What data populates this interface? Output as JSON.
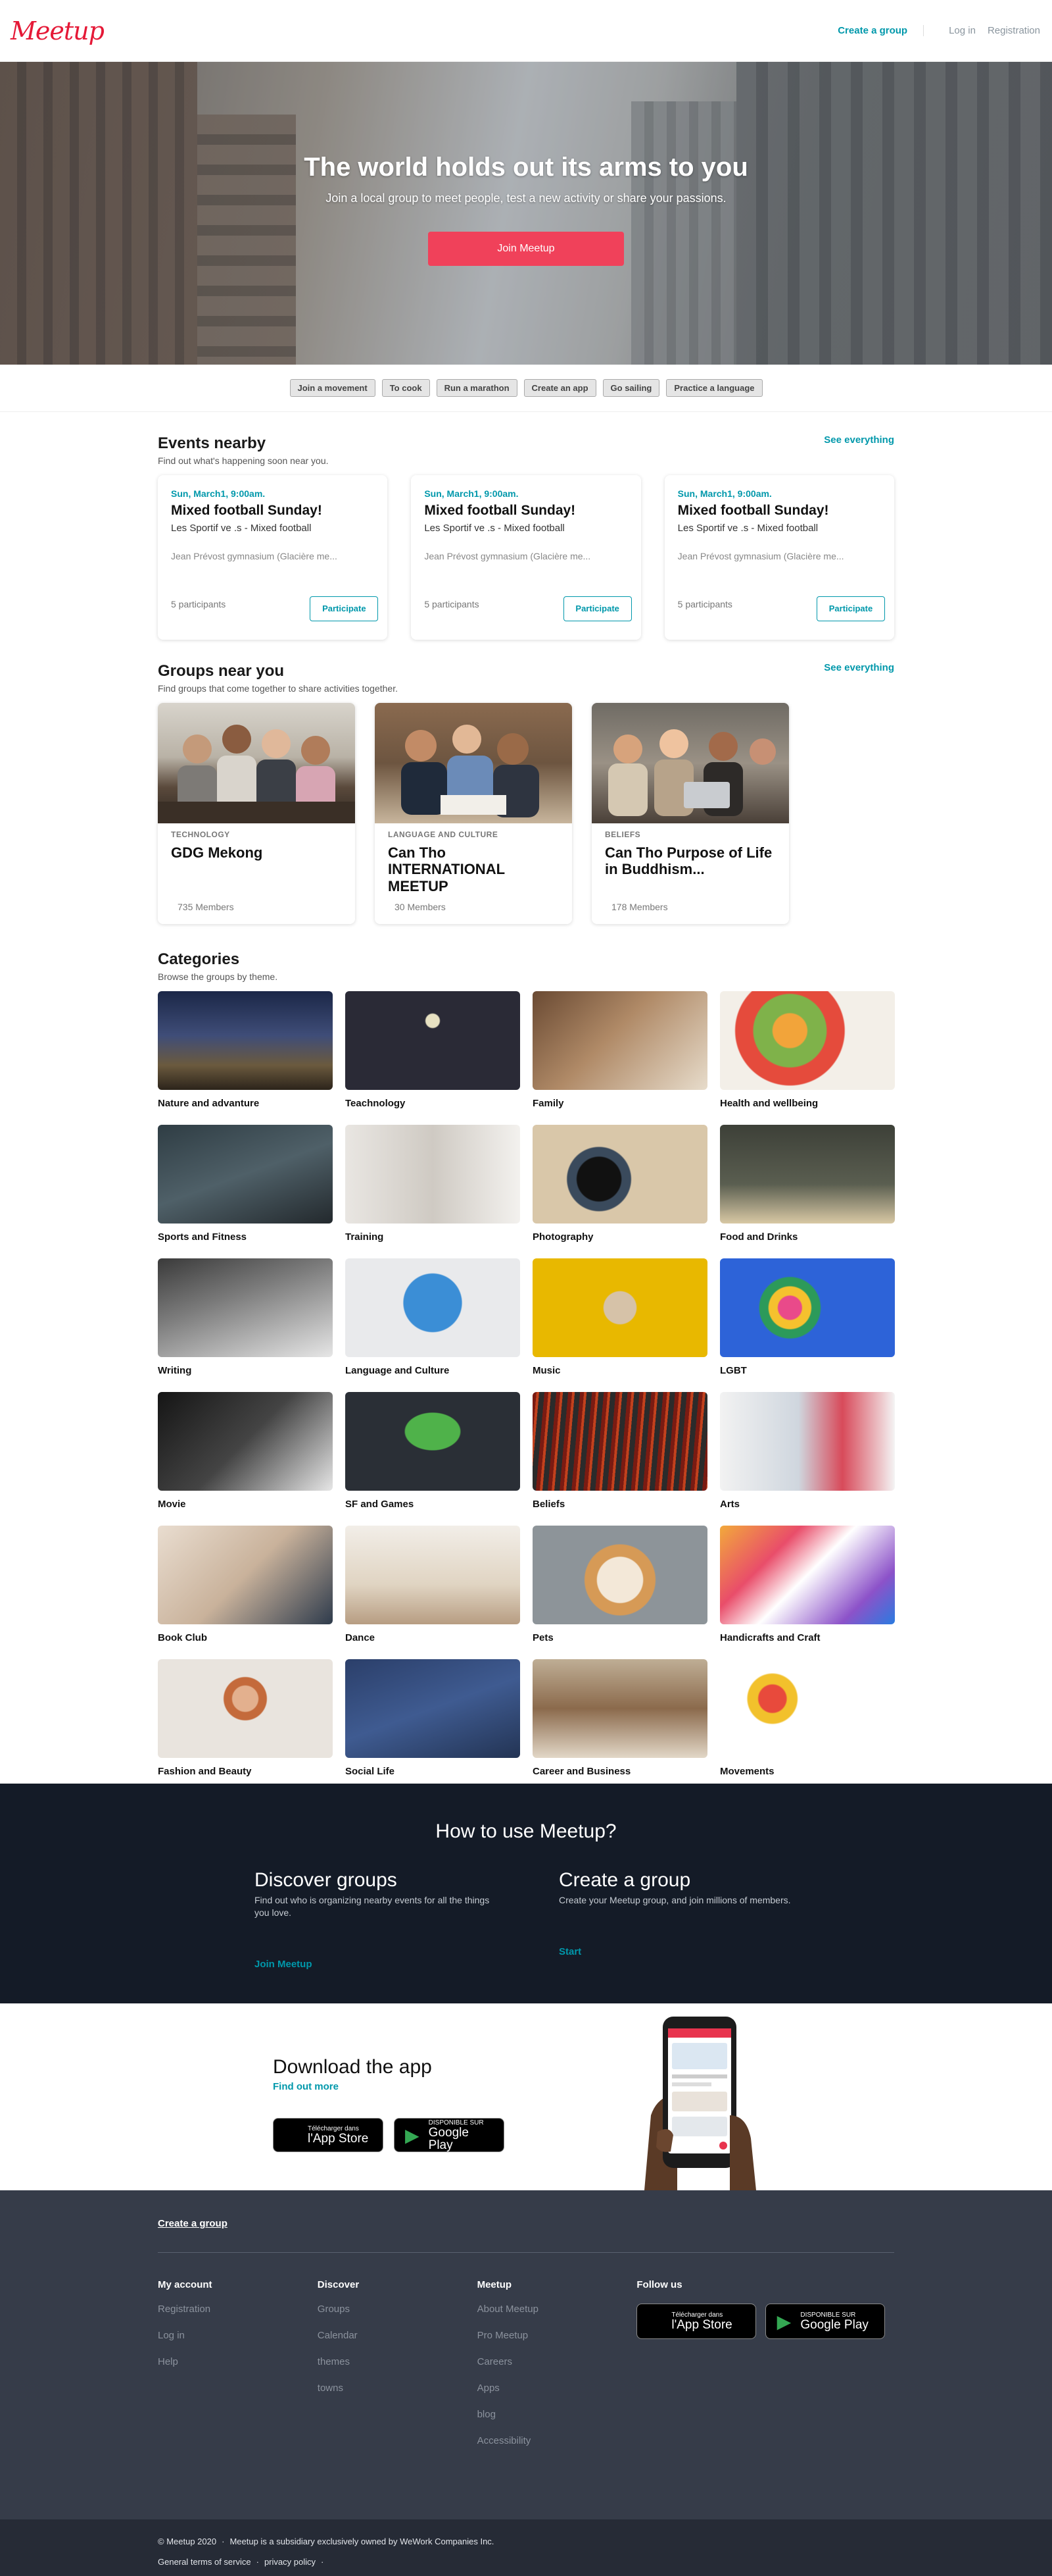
{
  "header": {
    "logo": "Meetup",
    "create_group": "Create a group",
    "login": "Log in",
    "registration": "Registration"
  },
  "hero": {
    "title": "The world holds out its arms to you",
    "subtitle": "Join a local group to meet people, test a new activity or share your passions.",
    "button": "Join Meetup"
  },
  "chips": [
    "Join a movement",
    "To cook",
    "Run a marathon",
    "Create an app",
    "Go sailing",
    "Practice a language"
  ],
  "events": {
    "title": "Events nearby",
    "subtitle": "Find out what's happening soon near you.",
    "see_all": "See everything",
    "items": [
      {
        "date": "Sun, March1, 9:00am.",
        "title": "Mixed football Sunday!",
        "group": "Les Sportif ve .s - Mixed football",
        "place": "Jean Prévost gymnasium (Glacière me...",
        "participants": "5 participants",
        "button": "Participate"
      },
      {
        "date": "Sun, March1, 9:00am.",
        "title": "Mixed football Sunday!",
        "group": "Les Sportif ve .s - Mixed football",
        "place": "Jean Prévost gymnasium (Glacière me...",
        "participants": "5 participants",
        "button": "Participate"
      },
      {
        "date": "Sun, March1, 9:00am.",
        "title": "Mixed football Sunday!",
        "group": "Les Sportif ve .s - Mixed football",
        "place": "Jean Prévost gymnasium (Glacière me...",
        "participants": "5 participants",
        "button": "Participate"
      }
    ]
  },
  "groups": {
    "title": "Groups near you",
    "subtitle": "Find groups that come together to share activities together.",
    "see_all": "See everything",
    "items": [
      {
        "category": "TECHNOLOGY",
        "name": "GDG Mekong",
        "members": "735 Members"
      },
      {
        "category": "LANGUAGE AND CULTURE",
        "name": "Can Tho INTERNATIONAL MEETUP",
        "members": "30 Members"
      },
      {
        "category": "BELIEFS",
        "name": "Can Tho Purpose of Life in Buddhism...",
        "members": "178 Members"
      }
    ]
  },
  "categories": {
    "title": "Categories",
    "subtitle": "Browse the groups by theme.",
    "items": [
      "Nature and advanture",
      "Teachnology",
      "Family",
      "Health and wellbeing",
      "Sports and Fitness",
      "Training",
      "Photography",
      "Food and Drinks",
      "Writing",
      "Language and Culture",
      "Music",
      "LGBT",
      "Movie",
      "SF and Games",
      "Beliefs",
      "Arts",
      "Book Club",
      "Dance",
      "Pets",
      "Handicrafts and Craft",
      "Fashion and Beauty",
      "Social Life",
      "Career and Business",
      "Movements"
    ]
  },
  "howto": {
    "title": "How to use Meetup?",
    "discover": {
      "title": "Discover groups",
      "text": "Find out who is organizing nearby events for all the things you love.",
      "link": "Join Meetup"
    },
    "create": {
      "title": "Create a group",
      "text": "Create your Meetup group, and join millions of members.",
      "link": "Start"
    }
  },
  "app": {
    "title": "Download the app",
    "link": "Find out more",
    "appstore_small": "Télécharger dans",
    "appstore_big": "l'App Store",
    "play_small": "DISPONIBLE SUR",
    "play_big": "Google Play"
  },
  "footer": {
    "create_group": "Create a group",
    "my_account": {
      "title": "My account",
      "links": [
        "Registration",
        "Log in",
        "Help"
      ]
    },
    "discover": {
      "title": "Discover",
      "links": [
        "Groups",
        "Calendar",
        "themes",
        "towns"
      ]
    },
    "meetup": {
      "title": "Meetup",
      "links": [
        "About Meetup",
        "Pro Meetup",
        "Careers",
        "Apps",
        "blog",
        "Accessibility"
      ]
    },
    "follow": {
      "title": "Follow us"
    }
  },
  "legal": {
    "copyright": "© Meetup 2020",
    "sep": "·",
    "subsidiary": "Meetup is a subsidiary exclusively owned by WeWork Companies Inc.",
    "terms": "General terms of service",
    "privacy": "privacy policy"
  },
  "colors": {
    "accent": "#0098ab",
    "brand": "#e51937",
    "hero_button": "#f0415a",
    "dark_section": "#141b27",
    "footer": "#363c49"
  }
}
